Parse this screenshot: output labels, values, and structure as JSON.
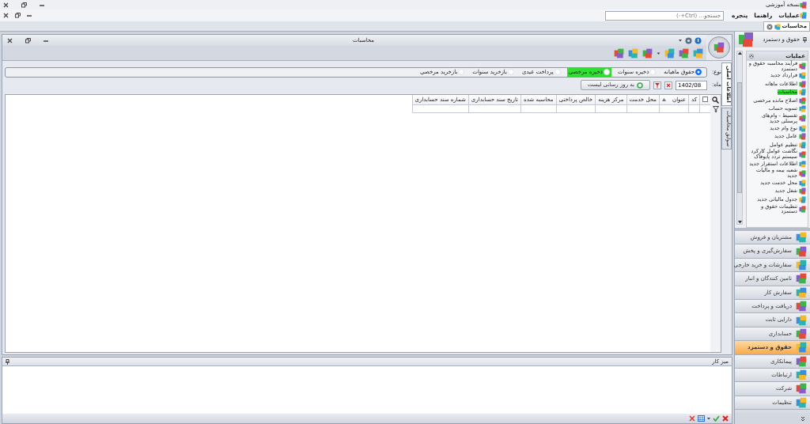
{
  "app": {
    "title": "نسخه آموزشی"
  },
  "menu": {
    "items": [
      {
        "label": "عملیات"
      },
      {
        "label": "راهنما"
      },
      {
        "label": "پنجره"
      }
    ],
    "search": {
      "placeholder": "جستجو... (Ctrl+-)"
    }
  },
  "doc_tabs": [
    {
      "label": "محاسبات",
      "selected": true
    }
  ],
  "document": {
    "title": "محاسبات",
    "side_tabs": [
      {
        "label": "اطلاعات اصلی",
        "selected": true
      },
      {
        "label": "سوابق محاسبات",
        "selected": false
      }
    ],
    "type_label": "نوع:",
    "types": [
      {
        "label": "حقوق ماهیانه",
        "selected": true,
        "highlighted": false
      },
      {
        "label": "ذخیره سنوات",
        "selected": false,
        "highlighted": false
      },
      {
        "label": "ذخیره مرخصی",
        "selected": false,
        "highlighted": true
      },
      {
        "label": "پرداخت عیدی",
        "selected": false,
        "highlighted": false
      },
      {
        "label": "بازخرید سنوات",
        "selected": false,
        "highlighted": false
      },
      {
        "label": "بازخرید مرخصی",
        "selected": false,
        "highlighted": false
      }
    ],
    "month_label": "ماه:",
    "month": "1402/08",
    "refresh_button": "به روز رسانی لیست",
    "select_all_checked": false,
    "columns": [
      {
        "label": "کد",
        "sorted": false
      },
      {
        "label": "عنوان",
        "sorted": true
      },
      {
        "label": "محل خدمت",
        "sorted": false
      },
      {
        "label": "مرکز هزینه",
        "sorted": false
      },
      {
        "label": "خالص پرداختی",
        "sorted": false
      },
      {
        "label": "محاسبه شده",
        "sorted": false
      },
      {
        "label": "تاریخ سند حسابداری",
        "sorted": false
      },
      {
        "label": "شماره سند حسابداری",
        "sorted": false
      }
    ]
  },
  "workspace": {
    "title": "میز کار"
  },
  "nav": {
    "title": "حقوق و دستمزد",
    "group": "عملیات",
    "items": [
      {
        "label": "فرآیند محاسبه حقوق و دستمزد",
        "highlighted": false
      },
      {
        "label": "قرارداد جدید",
        "highlighted": false
      },
      {
        "label": "اطلاعات ماهانه",
        "highlighted": false
      },
      {
        "label": "محاسبات",
        "highlighted": true
      },
      {
        "label": "اصلاح مانده مرخصی",
        "highlighted": false
      },
      {
        "label": "تسویه حساب",
        "highlighted": false
      },
      {
        "label": "تقسیط - وام‌های پرسنلی جدید",
        "highlighted": false
      },
      {
        "label": "نوع وام جدید",
        "highlighted": false
      },
      {
        "label": "عامل جدید",
        "highlighted": false
      },
      {
        "label": "تنظیم عوامل",
        "highlighted": false
      },
      {
        "label": "نگاشت عوامل کارکرد سیستم تردد پایوفاک",
        "highlighted": false
      },
      {
        "label": "اطلاعات استقرار جدید",
        "highlighted": false
      },
      {
        "label": "شعبه بیمه و مالیات جدید",
        "highlighted": false
      },
      {
        "label": "محل خدمت جدید",
        "highlighted": false
      },
      {
        "label": "شغل جدید",
        "highlighted": false
      },
      {
        "label": "جدول مالیاتی جدید",
        "highlighted": false
      },
      {
        "label": "تنظیمات حقوق و دستمزد",
        "highlighted": false
      }
    ],
    "modules": [
      {
        "label": "مشتریان و فروش",
        "selected": false
      },
      {
        "label": "سفارش‌گیری و پخش",
        "selected": false
      },
      {
        "label": "سفارشات و خرید خارجی",
        "selected": false
      },
      {
        "label": "تامین کنندگان و انبار",
        "selected": false
      },
      {
        "label": "سفارش کار",
        "selected": false
      },
      {
        "label": "دریافت و پرداخت",
        "selected": false
      },
      {
        "label": "دارایی ثابت",
        "selected": false
      },
      {
        "label": "حسابداری",
        "selected": false
      },
      {
        "label": "حقوق و دستمزد",
        "selected": true
      },
      {
        "label": "پیمانکاری",
        "selected": false
      },
      {
        "label": "ارتباطات",
        "selected": false
      },
      {
        "label": "شرکت",
        "selected": false
      },
      {
        "label": "تنظیمات",
        "selected": false
      }
    ]
  }
}
